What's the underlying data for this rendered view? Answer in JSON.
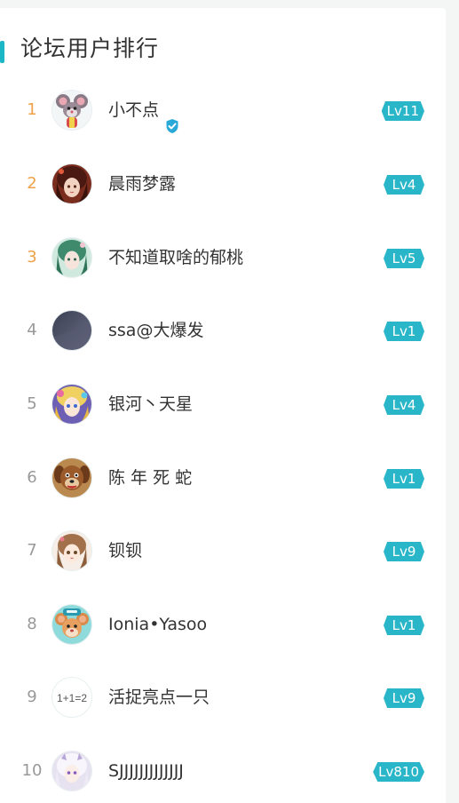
{
  "panel": {
    "title": "论坛用户排行",
    "accent_color": "#1bb7c7",
    "top_rank_color": "#f0a24a",
    "level_badge_color": "#2ab6c9"
  },
  "users": [
    {
      "rank": "1",
      "name": "小不点",
      "level": "Lv11",
      "verified": true,
      "avatar_icon": "mouse-character-avatar-icon"
    },
    {
      "rank": "2",
      "name": "晨雨梦露",
      "level": "Lv4",
      "verified": false,
      "avatar_icon": "anime-girl-avatar-icon"
    },
    {
      "rank": "3",
      "name": "不知道取啥的郁桃",
      "level": "Lv5",
      "verified": false,
      "avatar_icon": "green-anime-girl-avatar-icon"
    },
    {
      "rank": "4",
      "name": "ssa@大爆发",
      "level": "Lv1",
      "verified": false,
      "avatar_icon": "dark-gradient-avatar-icon"
    },
    {
      "rank": "5",
      "name": "银河丶天星",
      "level": "Lv4",
      "verified": false,
      "avatar_icon": "colorful-anime-avatar-icon"
    },
    {
      "rank": "6",
      "name": "陈 年 死 蛇",
      "level": "Lv1",
      "verified": false,
      "avatar_icon": "cartoon-dog-avatar-icon"
    },
    {
      "rank": "7",
      "name": "钡钡",
      "level": "Lv9",
      "verified": false,
      "avatar_icon": "anime-girl-brown-hair-avatar-icon"
    },
    {
      "rank": "8",
      "name": "Ionia•Yasoo",
      "level": "Lv1",
      "verified": false,
      "avatar_icon": "cartoon-mouse-avatar-icon"
    },
    {
      "rank": "9",
      "name": "活捉亮点一只",
      "level": "Lv9",
      "verified": false,
      "avatar_icon": "handwritten-math-avatar-icon",
      "avatar_text": "1+1=2"
    },
    {
      "rank": "10",
      "name": "SJJJJJJJJJJJJJ",
      "level": "Lv810",
      "verified": false,
      "avatar_icon": "white-hair-anime-avatar-icon"
    }
  ]
}
